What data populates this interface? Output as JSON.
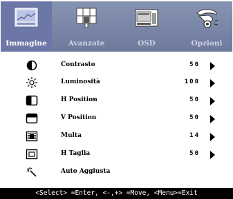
{
  "tabs": [
    {
      "label": "Immagine",
      "icon": "picture-icon",
      "active": true
    },
    {
      "label": "Avanzate",
      "icon": "grid-settings-icon",
      "active": false
    },
    {
      "label": "OSD",
      "icon": "osd-window-icon",
      "active": false
    },
    {
      "label": "Opzioni",
      "icon": "hand-options-icon",
      "active": false
    }
  ],
  "items": [
    {
      "icon": "contrast-icon",
      "label": "Contrasto",
      "value": "50",
      "arrow": true
    },
    {
      "icon": "brightness-icon",
      "label": "Luminosità",
      "value": "100",
      "arrow": true
    },
    {
      "icon": "h-position-icon",
      "label": "H Position",
      "value": "50",
      "arrow": true
    },
    {
      "icon": "v-position-icon",
      "label": "V Position",
      "value": "50",
      "arrow": true
    },
    {
      "icon": "phase-icon",
      "label": "Multa",
      "value": "14",
      "arrow": true
    },
    {
      "icon": "clock-icon",
      "label": "H Taglia",
      "value": "50",
      "arrow": true
    },
    {
      "icon": "auto-adjust-icon",
      "label": "Auto Aggiusta",
      "value": "",
      "arrow": false
    }
  ],
  "footer": {
    "text": "<Select> =Enter, <-,+> =Move, <Menu>=Exit"
  },
  "colors": {
    "tabbar": "#7b87a8",
    "active_tab": "#6c77a8",
    "footer_bg": "#000000"
  }
}
